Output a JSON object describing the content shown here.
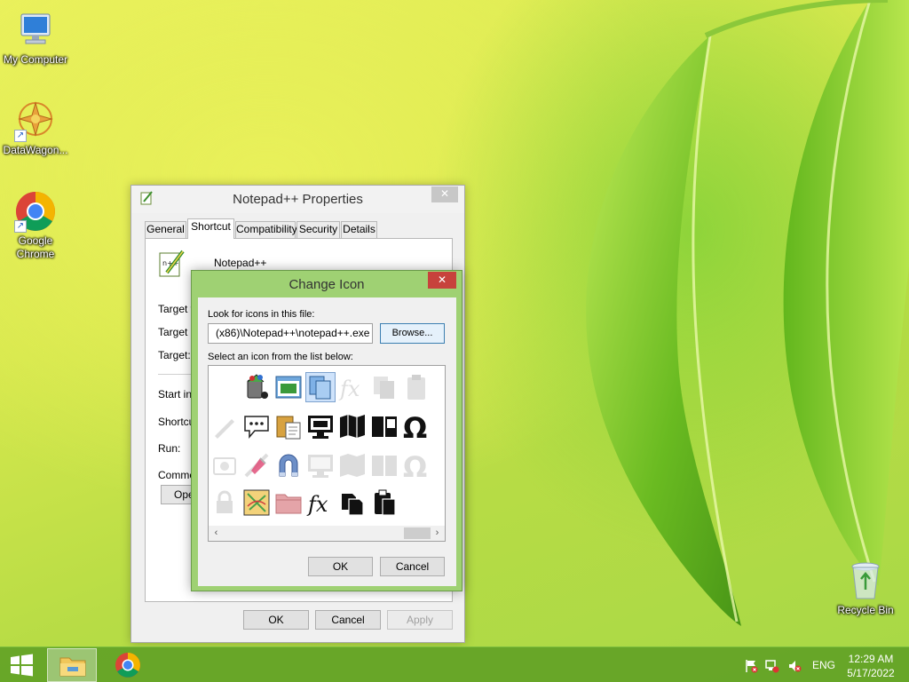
{
  "desktop": {
    "icons": [
      {
        "label": "My Computer"
      },
      {
        "label": "DataWagon..."
      },
      {
        "label": "Google Chrome"
      },
      {
        "label": "Recycle Bin"
      }
    ]
  },
  "properties_window": {
    "title": "Notepad++ Properties",
    "close_glyph": "✕",
    "tabs": [
      "General",
      "Shortcut",
      "Compatibility",
      "Security",
      "Details"
    ],
    "active_tab": "Shortcut",
    "shortcut_name": "Notepad++",
    "fields": [
      "Target ty",
      "Target lo",
      "Target:",
      "Start in:",
      "Shortcut",
      "Run:",
      "Commen"
    ],
    "open_button": "Oper",
    "ok_label": "OK",
    "cancel_label": "Cancel",
    "apply_label": "Apply"
  },
  "change_icon_dialog": {
    "title": "Change Icon",
    "close_glyph": "✕",
    "look_label": "Look for icons in this file:",
    "path_value": "(x86)\\Notepad++\\notepad++.exe",
    "browse_label": "Browse...",
    "list_label": "Select an icon from the list below:",
    "icons": [
      "blank-icon",
      "paint-bucket-icon",
      "window-layout-icon",
      "copy-pages-icon",
      "function-faded-icon",
      "copy-faded-icon",
      "clipboard-faded-icon",
      "pencil-faded-icon",
      "speech-bubble-icon",
      "paste-icon",
      "monitor-icon",
      "map-icon",
      "book-icon",
      "omega-icon",
      "camera-faded-icon",
      "pin-icon",
      "magnet-icon",
      "monitor-faded-icon",
      "map-faded-icon",
      "book-faded-icon",
      "omega-faded-icon",
      "lock-faded-icon",
      "document-map-icon",
      "folder-icon",
      "function-icon",
      "copy-icon",
      "clipboard-icon",
      "blank-icon"
    ],
    "selected_index": 3,
    "scroll_left": "‹",
    "scroll_right": "›",
    "ok_label": "OK",
    "cancel_label": "Cancel"
  },
  "taskbar": {
    "items": [
      "start-icon",
      "file-explorer-icon",
      "chrome-icon"
    ],
    "tray": [
      "flag-icon",
      "network-icon",
      "volume-mute-icon"
    ],
    "language": "ENG",
    "time": "12:29 AM",
    "date": "5/17/2022"
  }
}
